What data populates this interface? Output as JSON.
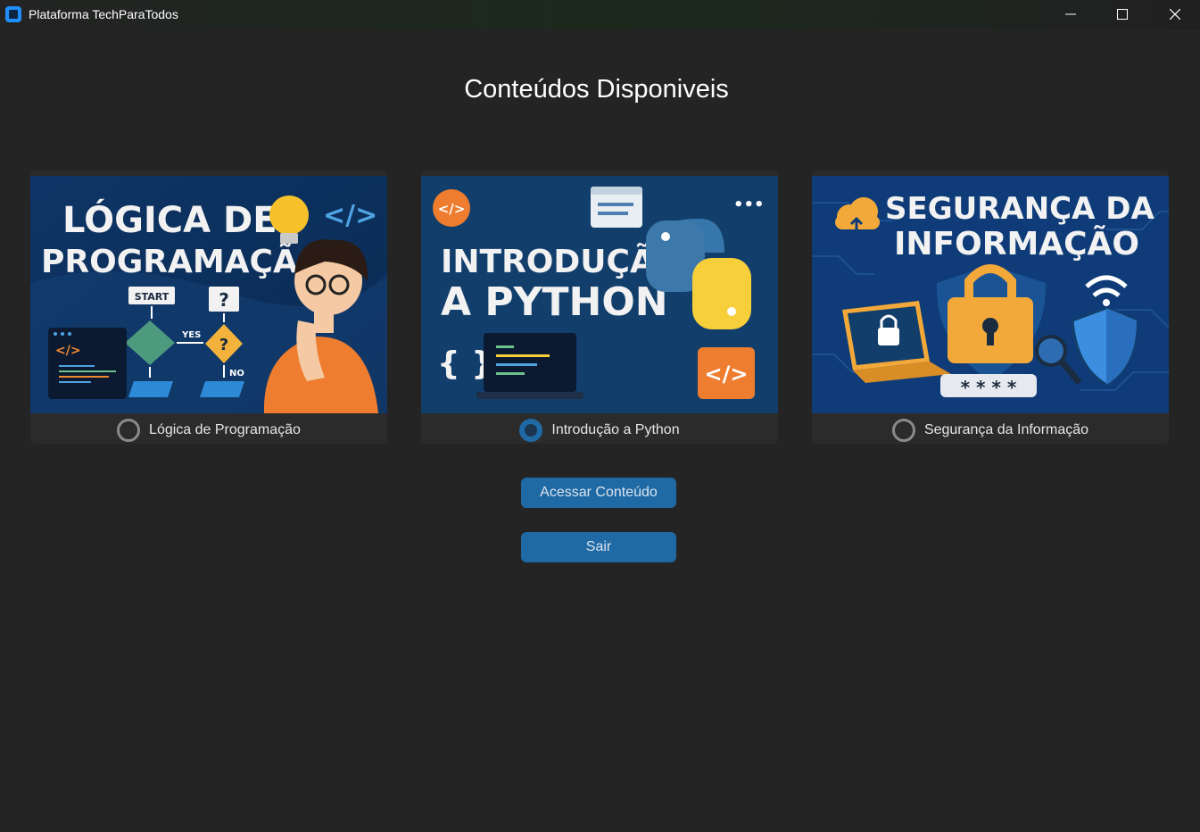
{
  "window": {
    "title": "Plataforma TechParaTodos",
    "controls": [
      "minimize",
      "maximize",
      "close"
    ]
  },
  "page": {
    "heading": "Conteúdos Disponiveis"
  },
  "cards": [
    {
      "label": "Lógica de Programação",
      "checked": false,
      "image": {
        "title_line1": "LÓGICA DE",
        "title_line2": "PROGRAMAÇÃO",
        "flow_start": "START",
        "flow_question": "?",
        "flow_yes": "YES",
        "flow_no": "NO",
        "code_tag": "</>"
      }
    },
    {
      "label": "Introdução a Python",
      "checked": true,
      "image": {
        "title_line1": "INTRODUÇÃO",
        "title_line2": "A PYTHON",
        "braces": "{ }",
        "code_tag": "</>"
      }
    },
    {
      "label": "Segurança da Informação",
      "checked": false,
      "image": {
        "title_line1": "SEGURANÇA DA",
        "title_line2": "INFORMAÇÃO",
        "password": "* * * *"
      }
    }
  ],
  "buttons": {
    "access_label": "Acessar Conteúdo",
    "exit_label": "Sair"
  },
  "colors": {
    "background": "#242424",
    "card": "#2b2b2b",
    "accent": "#1f6aa5",
    "thumb_blue": "#103a6a"
  }
}
